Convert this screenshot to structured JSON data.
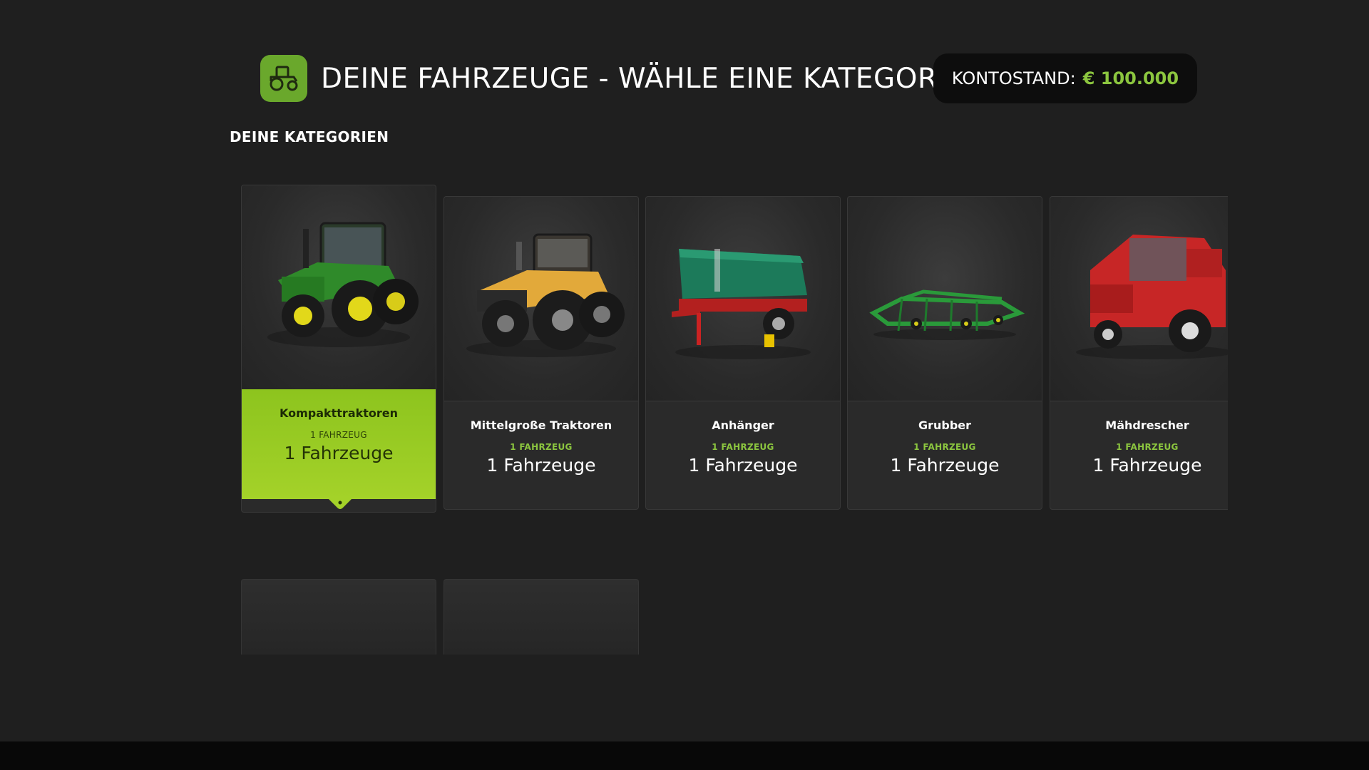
{
  "header": {
    "icon": "tractor-icon",
    "title": "DEINE FAHRZEUGE - WÄHLE EINE KATEGORIE",
    "balance_label": "KONTOSTAND:",
    "balance_value": "€ 100.000"
  },
  "section": {
    "title": "DEINE KATEGORIEN"
  },
  "categories": [
    {
      "name": "Kompakttraktoren",
      "count_small": "1 FAHRZEUG",
      "count_big": "1 Fahrzeuge",
      "selected": true,
      "icon": "compact-tractor-image"
    },
    {
      "name": "Mittelgroße Traktoren",
      "count_small": "1 FAHRZEUG",
      "count_big": "1 Fahrzeuge",
      "selected": false,
      "icon": "medium-tractor-image"
    },
    {
      "name": "Anhänger",
      "count_small": "1 FAHRZEUG",
      "count_big": "1 Fahrzeuge",
      "selected": false,
      "icon": "trailer-image"
    },
    {
      "name": "Grubber",
      "count_small": "1 FAHRZEUG",
      "count_big": "1 Fahrzeuge",
      "selected": false,
      "icon": "cultivator-image"
    },
    {
      "name": "Mähdrescher",
      "count_small": "1 FAHRZEUG",
      "count_big": "1 Fahrzeuge",
      "selected": false,
      "icon": "combine-harvester-image"
    }
  ],
  "colors": {
    "accent": "#8cc63f",
    "selected_card": "#9bcc25",
    "background": "#1f1f1f"
  }
}
